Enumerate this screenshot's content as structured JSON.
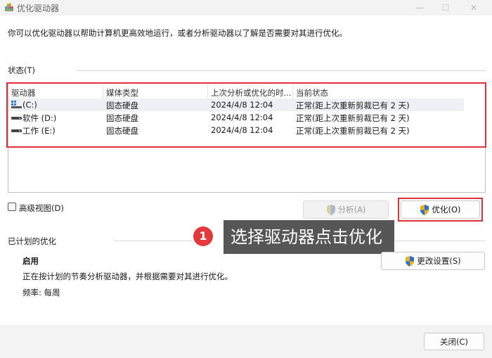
{
  "window": {
    "title": "优化驱动器",
    "minimize_glyph": "—",
    "maximize_glyph": "☐",
    "close_glyph": "✕"
  },
  "description": "你可以优化驱动器以帮助计算机更高效地运行，或者分析驱动器以了解是否需要对其进行优化。",
  "status": {
    "label": "状态(T)",
    "columns": [
      "驱动器",
      "媒体类型",
      "上次分析或优化的时...",
      "当前状态"
    ],
    "drives": [
      {
        "name": "(C:)",
        "media": "固态硬盘",
        "last": "2024/4/8 12:04",
        "state": "正常(距上次重新剪裁已有 2 天)",
        "icon": "windows-drive-icon"
      },
      {
        "name": "软件 (D:)",
        "media": "固态硬盘",
        "last": "2024/4/8 12:04",
        "state": "正常(距上次重新剪裁已有 2 天)",
        "icon": "drive-icon"
      },
      {
        "name": "工作 (E:)",
        "media": "固态硬盘",
        "last": "2024/4/8 12:04",
        "state": "正常(距上次重新剪裁已有 2 天)",
        "icon": "drive-icon"
      }
    ]
  },
  "advanced_view_label": "高级视图(D)",
  "buttons": {
    "analyze": "分析(A)",
    "optimize": "优化(O)",
    "change_settings": "更改设置(S)",
    "close": "关闭(C)"
  },
  "callout": {
    "number": "1",
    "text": "选择驱动器点击优化"
  },
  "scheduled": {
    "label": "已计划的优化",
    "state": "启用",
    "description": "正在按计划的节奏分析驱动器，并根据需要对其进行优化。",
    "frequency": "频率: 每周"
  },
  "colors": {
    "highlight": "#e0303a",
    "callout_badge": "#e4393c",
    "callout_bg": "#565656"
  }
}
